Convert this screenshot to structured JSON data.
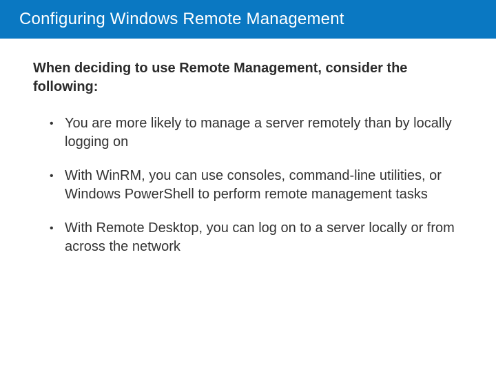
{
  "header": {
    "title": "Configuring Windows Remote Management"
  },
  "body": {
    "lead": "When deciding to use Remote Management, consider the following:",
    "bullets": [
      "You are more likely to manage a server remotely than by locally logging on",
      "With WinRM, you can use consoles, command-line utilities, or Windows PowerShell to perform remote management tasks",
      "With Remote Desktop, you can log on to a server locally or from across the network"
    ]
  }
}
